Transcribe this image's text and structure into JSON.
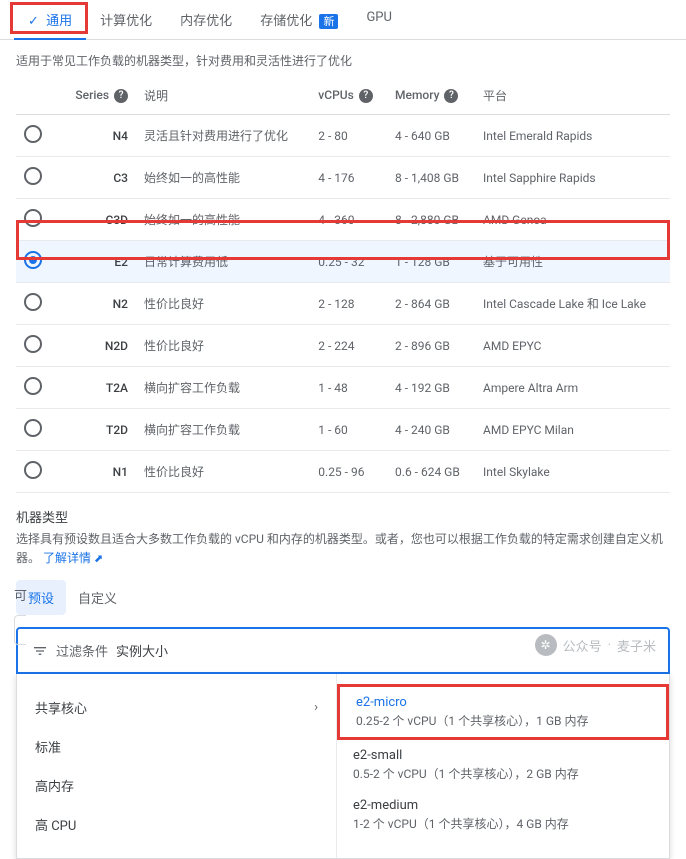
{
  "tabs": [
    {
      "label": "通用",
      "active": true,
      "check": true
    },
    {
      "label": "计算优化"
    },
    {
      "label": "内存优化"
    },
    {
      "label": "存储优化",
      "badge": "新"
    },
    {
      "label": "GPU"
    }
  ],
  "top_desc": "适用于常见工作负载的机器类型，针对费用和灵活性进行了优化",
  "table": {
    "headers": {
      "series": "Series",
      "desc": "说明",
      "vcpus": "vCPUs",
      "memory": "Memory",
      "platform": "平台"
    },
    "rows": [
      {
        "series": "N4",
        "desc": "灵活且针对费用进行了优化",
        "vcpus": "2 - 80",
        "memory": "4 - 640 GB",
        "platform": "Intel Emerald Rapids"
      },
      {
        "series": "C3",
        "desc": "始终如一的高性能",
        "vcpus": "4 - 176",
        "memory": "8 - 1,408 GB",
        "platform": "Intel Sapphire Rapids"
      },
      {
        "series": "C3D",
        "desc": "始终如一的高性能",
        "vcpus": "4 - 360",
        "memory": "8 - 2,880 GB",
        "platform": "AMD Genoa"
      },
      {
        "series": "E2",
        "desc": "日常计算费用低",
        "vcpus": "0.25 - 32",
        "memory": "1 - 128 GB",
        "platform": "基于可用性",
        "selected": true
      },
      {
        "series": "N2",
        "desc": "性价比良好",
        "vcpus": "2 - 128",
        "memory": "2 - 864 GB",
        "platform": "Intel Cascade Lake 和 Ice Lake"
      },
      {
        "series": "N2D",
        "desc": "性价比良好",
        "vcpus": "2 - 224",
        "memory": "2 - 896 GB",
        "platform": "AMD EPYC"
      },
      {
        "series": "T2A",
        "desc": "横向扩容工作负载",
        "vcpus": "1 - 48",
        "memory": "4 - 192 GB",
        "platform": "Ampere Altra Arm"
      },
      {
        "series": "T2D",
        "desc": "横向扩容工作负载",
        "vcpus": "1 - 60",
        "memory": "4 - 240 GB",
        "platform": "AMD EPYC Milan"
      },
      {
        "series": "N1",
        "desc": "性价比良好",
        "vcpus": "0.25 - 96",
        "memory": "0.6 - 624 GB",
        "platform": "Intel Skylake"
      }
    ]
  },
  "machine_type": {
    "title": "机器类型",
    "desc": "选择具有预设数且适合大多数工作负载的 vCPU 和内存的机器类型。或者，您也可以根据工作负载的特定需求创建自定义机器。",
    "learn_more": "了解详情"
  },
  "sub_tabs": [
    {
      "label": "预设",
      "active": true
    },
    {
      "label": "自定义"
    }
  ],
  "filter": {
    "label": "过滤条件",
    "value": "实例大小"
  },
  "categories": [
    {
      "label": "共享核心"
    },
    {
      "label": "标准"
    },
    {
      "label": "高内存"
    },
    {
      "label": "高 CPU"
    }
  ],
  "options": [
    {
      "name": "e2-micro",
      "detail": "0.25-2 个 vCPU（1 个共享核心），1 GB 内存",
      "highlight": true
    },
    {
      "name": "e2-small",
      "detail": "0.5-2 个 vCPU（1 个共享核心），2 GB 内存"
    },
    {
      "name": "e2-medium",
      "detail": "1-2 个 vCPU（1 个共享核心），4 GB 内存"
    }
  ],
  "left_cut_text": "可",
  "watermark": {
    "prefix": "公众号",
    "name": "麦子米"
  }
}
